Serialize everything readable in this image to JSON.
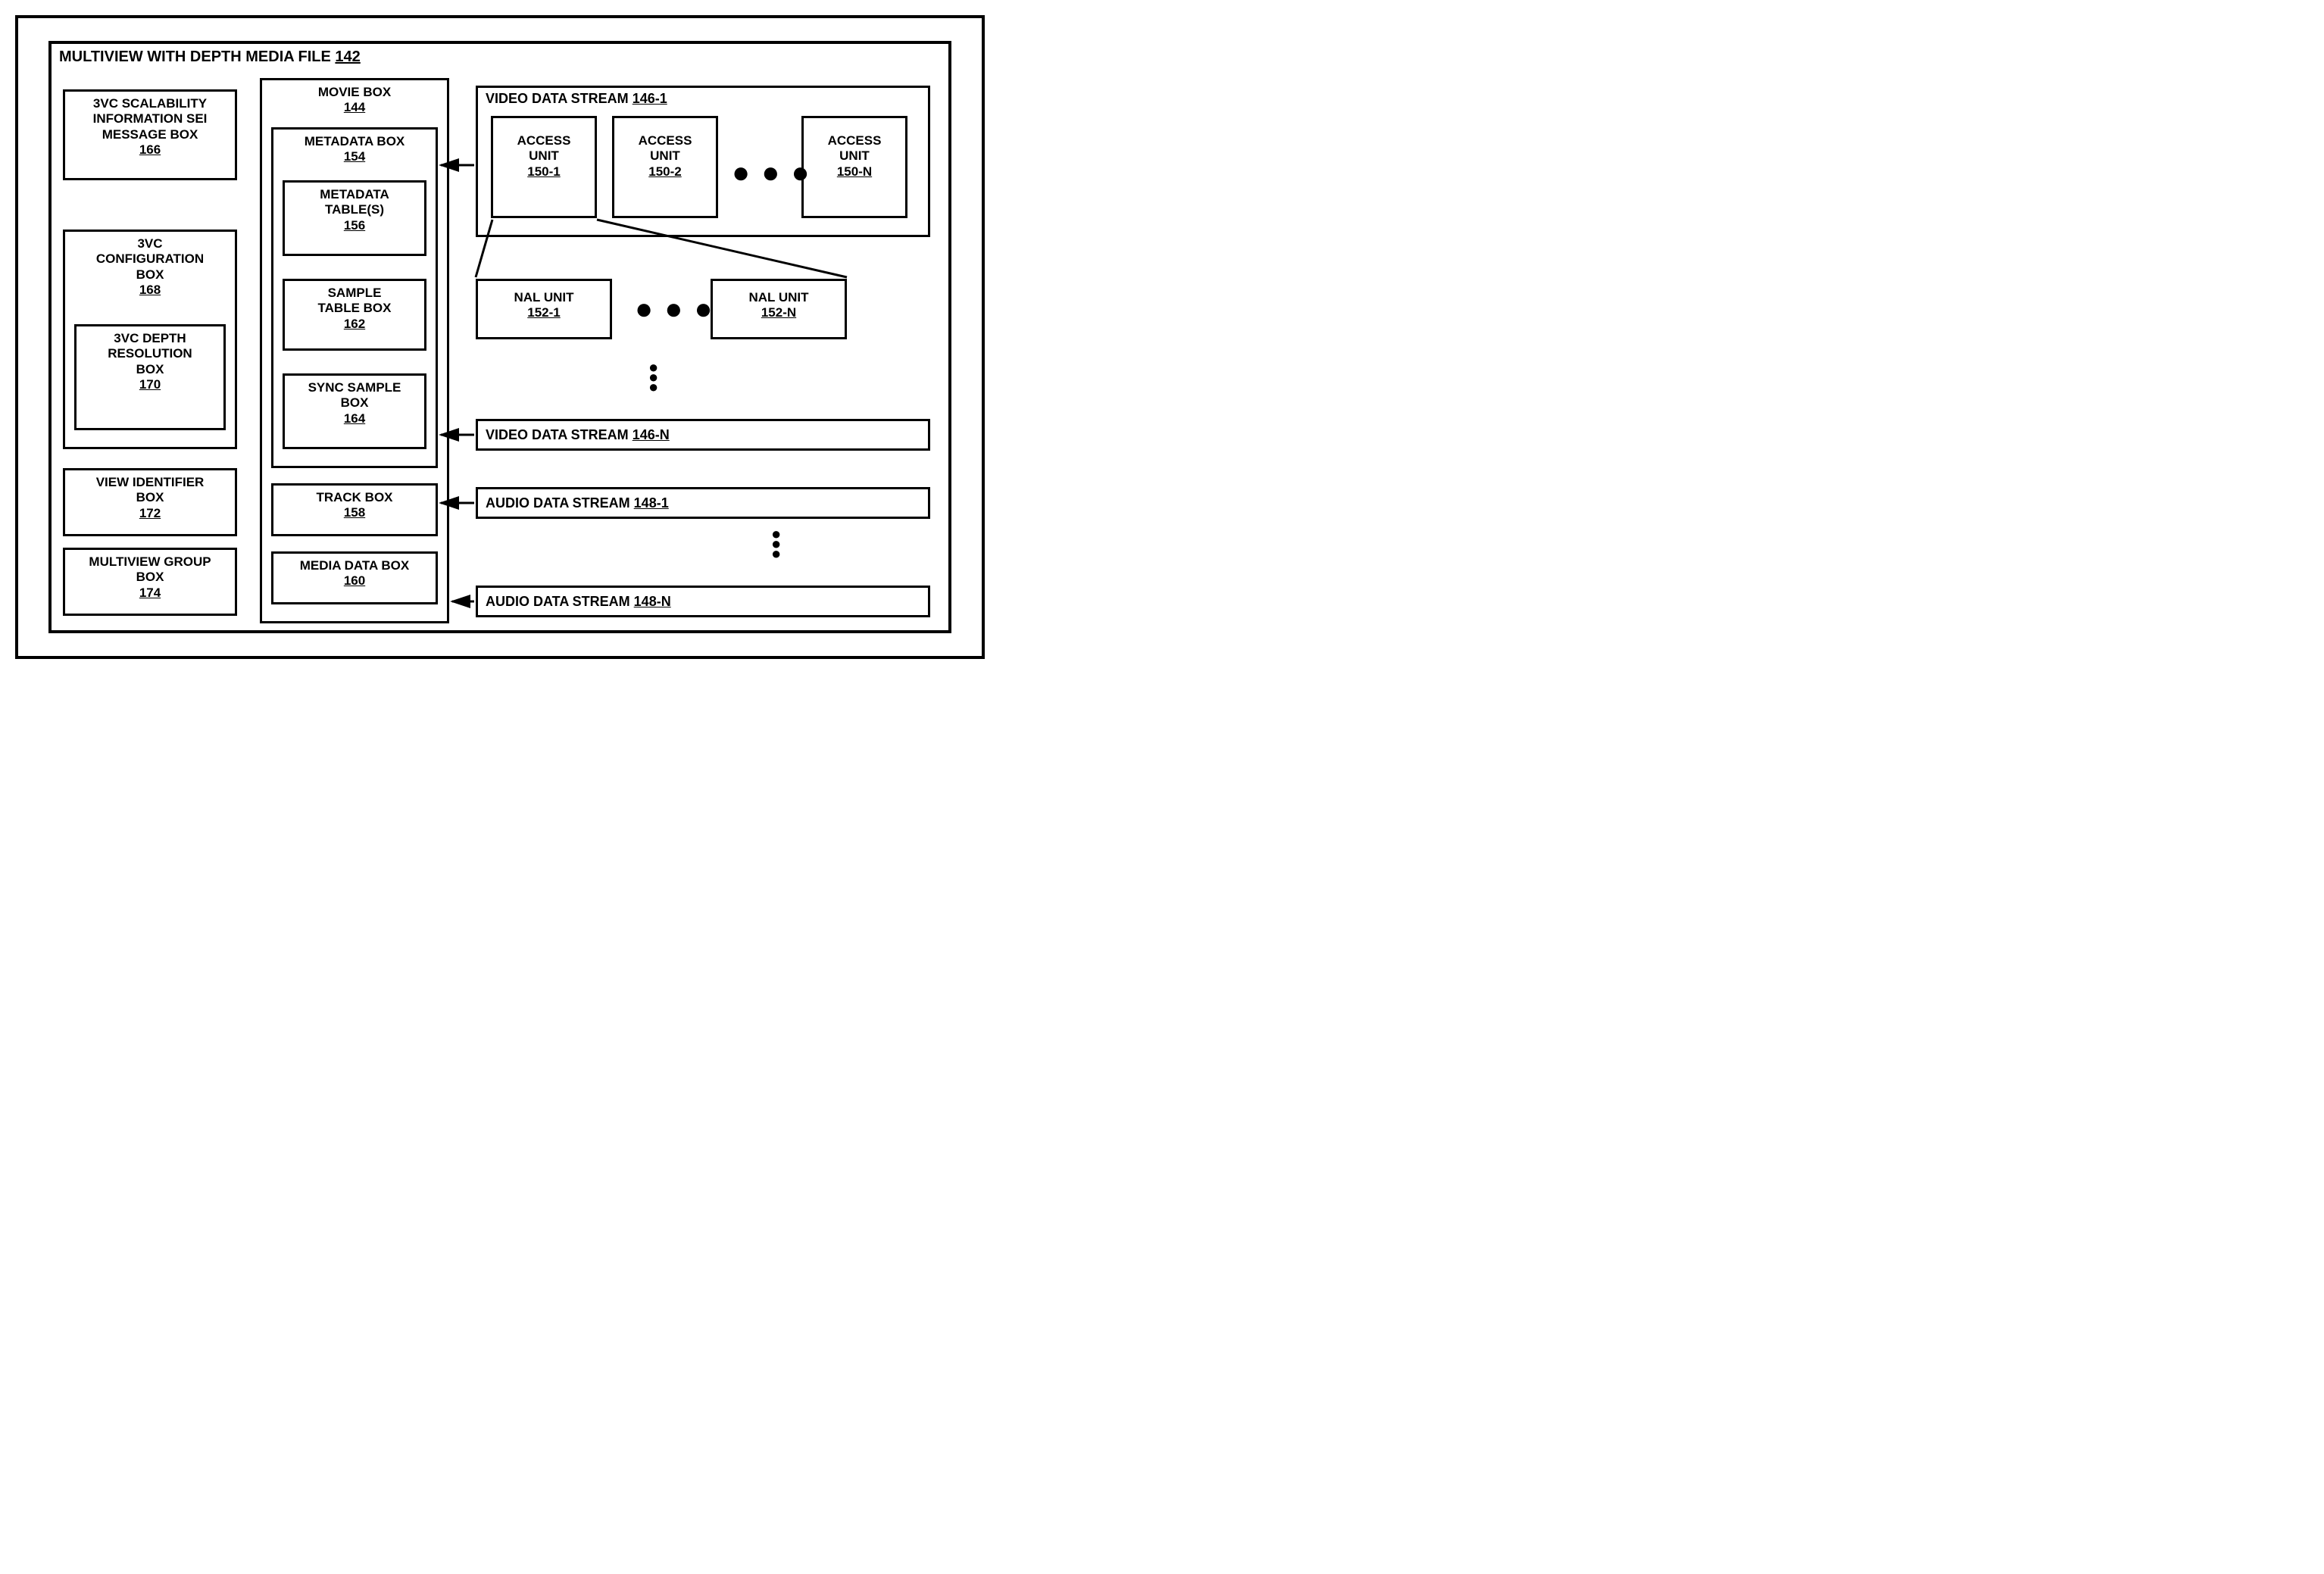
{
  "main": {
    "title": "MULTIVIEW WITH DEPTH MEDIA FILE",
    "num": "142"
  },
  "b166": {
    "t1": "3VC SCALABILITY",
    "t2": "INFORMATION SEI",
    "t3": "MESSAGE BOX",
    "num": "166"
  },
  "b168": {
    "t1": "3VC",
    "t2": "CONFIGURATION",
    "t3": "BOX",
    "num": "168"
  },
  "b170": {
    "t1": "3VC DEPTH",
    "t2": "RESOLUTION",
    "t3": "BOX",
    "num": "170"
  },
  "b172": {
    "t1": "VIEW IDENTIFIER",
    "t2": "BOX",
    "num": "172"
  },
  "b174": {
    "t1": "MULTIVIEW GROUP",
    "t2": "BOX",
    "num": "174"
  },
  "b144": {
    "t1": "MOVIE BOX",
    "num": "144"
  },
  "b154": {
    "t1": "METADATA BOX",
    "num": "154"
  },
  "b156": {
    "t1": "METADATA",
    "t2": "TABLE(S)",
    "num": "156"
  },
  "b162": {
    "t1": "SAMPLE",
    "t2": "TABLE BOX",
    "num": "162"
  },
  "b164": {
    "t1": "SYNC SAMPLE",
    "t2": "BOX",
    "num": "164"
  },
  "b158": {
    "t1": "TRACK BOX",
    "num": "158"
  },
  "b160": {
    "t1": "MEDIA DATA BOX",
    "num": "160"
  },
  "b1461": {
    "t1": "VIDEO DATA STREAM",
    "num": "146-1"
  },
  "b1501": {
    "t1": "ACCESS",
    "t2": "UNIT",
    "num": "150-1"
  },
  "b1502": {
    "t1": "ACCESS",
    "t2": "UNIT",
    "num": "150-2"
  },
  "b150N": {
    "t1": "ACCESS",
    "t2": "UNIT",
    "num": "150-N"
  },
  "b1521": {
    "t1": "NAL UNIT",
    "num": "152-1"
  },
  "b152N": {
    "t1": "NAL UNIT",
    "num": "152-N"
  },
  "b146N": {
    "t1": "VIDEO DATA STREAM",
    "num": "146-N"
  },
  "b1481": {
    "t1": "AUDIO DATA STREAM",
    "num": "148-1"
  },
  "b148N": {
    "t1": "AUDIO DATA STREAM",
    "num": "148-N"
  },
  "dots": "● ● ●"
}
